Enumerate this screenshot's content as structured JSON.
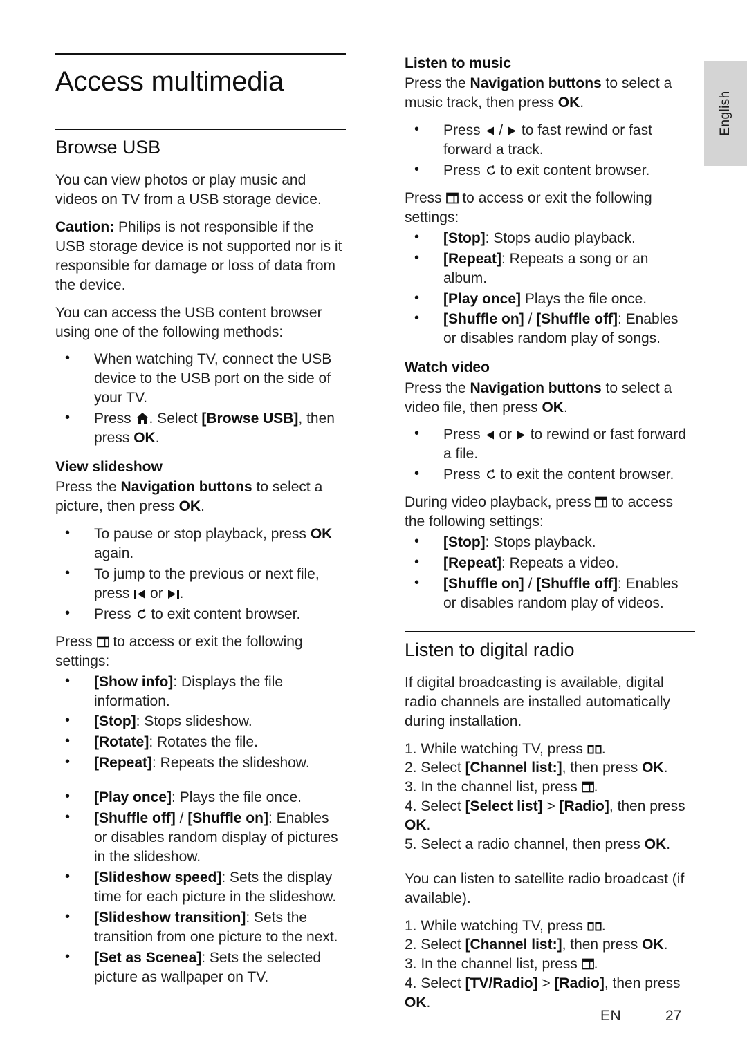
{
  "language_tab": {
    "label": "English"
  },
  "footer": {
    "lang_code": "EN",
    "page_number": "27"
  },
  "left_column": {
    "doc_title": "Access multimedia",
    "section_title": "Browse USB",
    "intro_para": "You can view photos or play music and videos on TV from a USB storage device.",
    "caution_label": "Caution:",
    "caution_text": " Philips is not responsible if the USB storage device is not supported nor is it responsible for damage or loss of data from the device.",
    "methods_para": "You can access the USB content browser using one of the following methods:",
    "methods_bullets": [
      {
        "text": "When watching TV, connect the USB device to the USB port on the side of your TV."
      },
      {
        "pre": "Press ",
        "icon": "home-icon",
        "mid": ". Select ",
        "bold": "[Browse USB]",
        "post": ", then press ",
        "bold2": "OK",
        "tail": "."
      }
    ],
    "slideshow": {
      "heading": "View slideshow",
      "intro_pre": "Press the ",
      "intro_bold": "Navigation buttons",
      "intro_mid": " to select a picture, then press ",
      "intro_bold2": "OK",
      "intro_tail": ".",
      "bullets": [
        {
          "pre": "To pause or stop playback, press ",
          "bold": "OK",
          "post": " again."
        },
        {
          "pre": "To jump to the previous or next file, press ",
          "icon": "skip-previous-icon",
          "mid": " or ",
          "icon2": "skip-next-icon",
          "post": "."
        },
        {
          "pre": "Press ",
          "icon": "return-icon",
          "post": " to exit content browser."
        }
      ],
      "settings_pre": "Press ",
      "settings_icon": "options-icon",
      "settings_post": " to access or exit the following settings:",
      "settings_items": [
        {
          "bold": "[Show info]",
          "rest": ": Displays the file information."
        },
        {
          "bold": "[Stop]",
          "rest": ": Stops slideshow."
        },
        {
          "bold": "[Rotate]",
          "rest": ": Rotates the file."
        },
        {
          "bold": "[Repeat]",
          "rest": ": Repeats the slideshow."
        },
        {
          "bold": "[Play once]",
          "rest": ": Plays the file once.",
          "gap_before": true
        },
        {
          "bold": "[Shuffle off]",
          "mid": " / ",
          "bold2": "[Shuffle on]",
          "rest": ": Enables or disables random display of pictures in the slideshow."
        },
        {
          "bold": "[Slideshow speed]",
          "rest": ": Sets the display time for each picture in the slideshow."
        },
        {
          "bold": "[Slideshow transition]",
          "rest": ": Sets the transition from one picture to the next."
        },
        {
          "bold": "[Set as Scenea]",
          "rest": ": Sets the selected picture as wallpaper on TV."
        }
      ]
    }
  },
  "right_column": {
    "music": {
      "heading": "Listen to music",
      "intro_pre": "Press the ",
      "intro_bold": "Navigation buttons",
      "intro_mid": " to select a music track, then press ",
      "intro_bold2": "OK",
      "intro_tail": ".",
      "bullets": [
        {
          "pre": "Press ",
          "icon": "left-arrow-icon",
          "mid": " / ",
          "icon2": "right-arrow-icon",
          "post": " to fast rewind or fast forward a track."
        },
        {
          "pre": "Press ",
          "icon": "return-icon",
          "post": " to exit content browser."
        }
      ],
      "settings_pre": "Press ",
      "settings_icon": "options-icon",
      "settings_post": " to access or exit the following settings:",
      "settings_items": [
        {
          "bold": "[Stop]",
          "rest": ": Stops audio playback."
        },
        {
          "bold": "[Repeat]",
          "rest": ": Repeats a song or an album."
        },
        {
          "bold": "[Play once]",
          "rest": " Plays the file once."
        },
        {
          "bold": "[Shuffle on]",
          "mid": " / ",
          "bold2": "[Shuffle off]",
          "rest": ": Enables or disables random play of songs."
        }
      ]
    },
    "video": {
      "heading": "Watch video",
      "intro_pre": "Press the ",
      "intro_bold": "Navigation buttons",
      "intro_mid": " to select a video file, then press ",
      "intro_bold2": "OK",
      "intro_tail": ".",
      "bullets": [
        {
          "pre": "Press ",
          "icon": "left-arrow-icon",
          "mid": " or ",
          "icon2": "right-arrow-icon",
          "post": " to rewind or fast forward a file."
        },
        {
          "pre": "Press ",
          "icon": "return-icon",
          "post": " to exit the content browser."
        }
      ],
      "settings_pre": "During video playback, press ",
      "settings_icon": "options-icon",
      "settings_post": " to access the following settings:",
      "settings_items": [
        {
          "bold": "[Stop]",
          "rest": ": Stops playback."
        },
        {
          "bold": "[Repeat]",
          "rest": ": Repeats a video."
        },
        {
          "bold": "[Shuffle on]",
          "mid": " / ",
          "bold2": "[Shuffle off]",
          "rest": ": Enables or disables random play of videos."
        }
      ]
    },
    "radio": {
      "section_title": "Listen to digital radio",
      "intro_para": "If digital broadcasting is available, digital radio channels are installed automatically during installation.",
      "steps_a": [
        {
          "num": "1. ",
          "pre": "While watching TV, press ",
          "icon": "guide-icon",
          "post": "."
        },
        {
          "num": "2. ",
          "pre": "Select ",
          "bold": "[Channel list:]",
          "post": ", then press ",
          "bold2": "OK",
          "tail": "."
        },
        {
          "num": "3. ",
          "pre": "In the channel list, press ",
          "icon": "options-icon",
          "post": "."
        },
        {
          "num": "4. ",
          "pre": "Select ",
          "bold": "[Select list]",
          "mid": " > ",
          "bold2": "[Radio]",
          "post": ", then press ",
          "bold3": "OK",
          "tail": "."
        },
        {
          "num": "5. ",
          "pre": "Select a radio channel, then press ",
          "bold": "OK",
          "tail": "."
        }
      ],
      "satellite_para": "You can listen to satellite radio broadcast (if available).",
      "steps_b": [
        {
          "num": "1. ",
          "pre": "While watching TV, press ",
          "icon": "guide-icon",
          "post": "."
        },
        {
          "num": "2. ",
          "pre": "Select ",
          "bold": "[Channel list:]",
          "post": ", then press ",
          "bold2": "OK",
          "tail": "."
        },
        {
          "num": "3. ",
          "pre": "In the channel list, press ",
          "icon": "options-icon",
          "post": "."
        },
        {
          "num": "4. ",
          "pre": "Select ",
          "bold": "[TV/Radio]",
          "mid": " > ",
          "bold2": "[Radio]",
          "post": ", then press ",
          "bold3": "OK",
          "tail": "."
        }
      ]
    }
  }
}
